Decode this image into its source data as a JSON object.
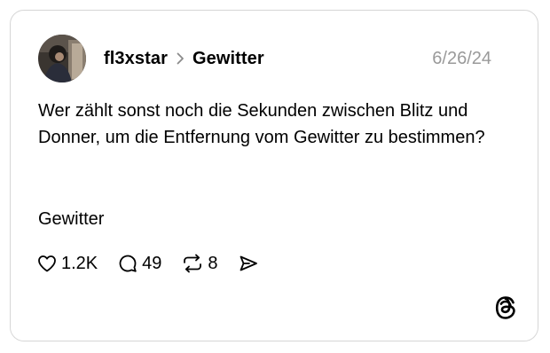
{
  "post": {
    "author": "fl3xstar",
    "topic": "Gewitter",
    "date": "6/26/24",
    "text": "Wer zählt sonst noch die Sekunden zwischen Blitz und Donner, um die Entfernung vom Gewitter zu bestimmen?",
    "tag": "Gewitter"
  },
  "stats": {
    "likes": "1.2K",
    "replies": "49",
    "reposts": "8"
  },
  "icons": {
    "avatar": "user-avatar-photo",
    "breadcrumb_separator": "chevron-right-icon",
    "like": "heart-icon",
    "reply": "speech-bubble-icon",
    "repost": "repost-arrows-icon",
    "share": "send-icon",
    "brand": "threads-logo-icon"
  },
  "colors": {
    "text": "#000000",
    "muted": "#9a9a9a",
    "border": "#d6d6d6"
  }
}
